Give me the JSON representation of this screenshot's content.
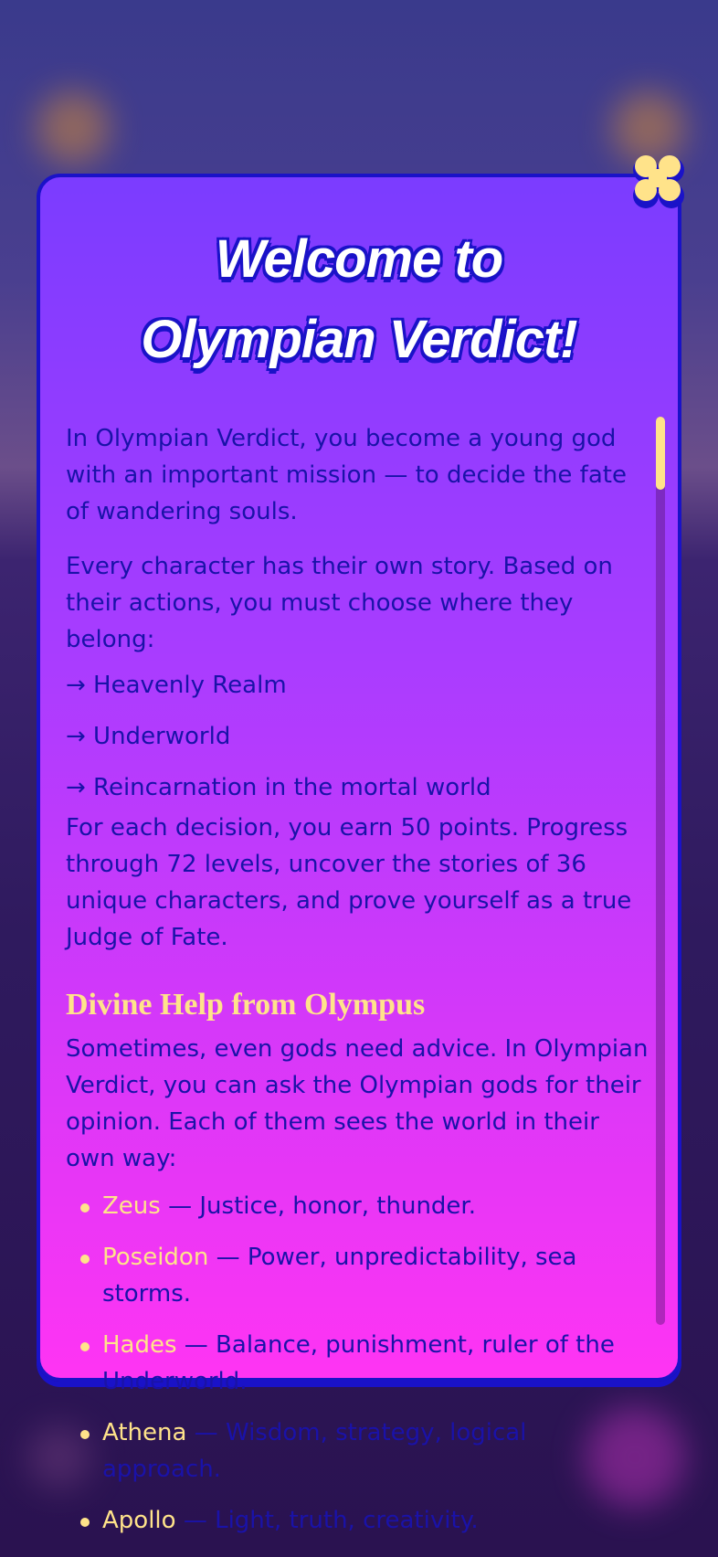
{
  "modal": {
    "title_line1": "Welcome to",
    "title_line2": "Olympian Verdict!",
    "close_icon": "close-icon"
  },
  "intro": {
    "p1": "In Olympian Verdict, you become a young god with an important mission — to decide the fate of wandering souls.",
    "p2": "Every character has their own story. Based on their actions, you must choose where they belong:",
    "choices": [
      "→ Heavenly Realm",
      "→ Underworld",
      "→ Reincarnation in the mortal world"
    ],
    "p3": "For each decision, you earn 50 points. Progress through 72 levels, uncover the stories of 36 unique characters, and prove yourself as a true Judge of Fate."
  },
  "divine_help": {
    "heading": "Divine Help from Olympus",
    "text": "Sometimes, even gods need advice. In Olympian Verdict, you can ask the Olympian gods for their opinion. Each of them sees the world in their own way:",
    "gods": [
      {
        "name": "Zeus",
        "desc": " — Justice, honor, thunder."
      },
      {
        "name": "Poseidon",
        "desc": " — Power, unpredictability, sea storms."
      },
      {
        "name": "Hades",
        "desc": " — Balance, punishment, ruler of the Underworld."
      },
      {
        "name": "Athena",
        "desc": " — Wisdom, strategy, logical approach."
      },
      {
        "name": "Apollo",
        "desc": " — Light, truth, creativity."
      }
    ]
  },
  "colors": {
    "accent_yellow": "#ffe38a",
    "outline_blue": "#1a12c8",
    "text_blue": "#1a12a8",
    "gradient_top": "#7b3cff",
    "gradient_bottom": "#ff34f3"
  },
  "scroll": {
    "position_fraction": 0.0
  }
}
